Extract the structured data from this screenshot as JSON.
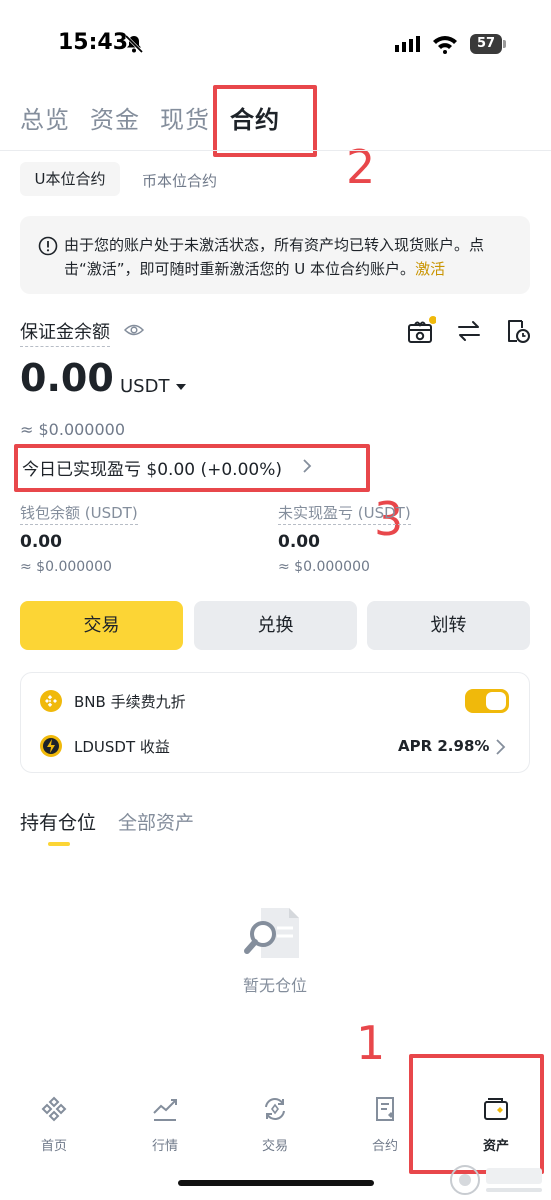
{
  "status_bar": {
    "time": "15:43",
    "battery": "57"
  },
  "top_tabs": [
    "总览",
    "资金",
    "现货",
    "合约"
  ],
  "sub_tabs": [
    "U本位合约",
    "币本位合约"
  ],
  "notice": {
    "text": "由于您的账户处于未激活状态，所有资产均已转入现货账户。点击“激活”，即可随时重新激活您的 U 本位合约账户。",
    "link": "激活"
  },
  "margin": {
    "label": "保证金余额",
    "amount": "0.00",
    "unit": "USDT",
    "usd_approx": "≈ $0.000000",
    "pnl_text": "今日已实现盈亏 $0.00 (+0.00%)"
  },
  "wallet": {
    "label": "钱包余额 (USDT)",
    "value": "0.00",
    "approx": "≈ $0.000000"
  },
  "unrealized": {
    "label": "未实现盈亏 (USDT)",
    "value": "0.00",
    "approx": "≈ $0.000000"
  },
  "actions": [
    "交易",
    "兑换",
    "划转"
  ],
  "bnb_row": {
    "label": "BNB 手续费九折",
    "toggle_on": true
  },
  "ld_row": {
    "label": "LDUSDT 收益",
    "apr": "APR 2.98%"
  },
  "position_tabs": [
    "持有仓位",
    "全部资产"
  ],
  "empty_text": "暂无仓位",
  "bottom_nav": [
    "首页",
    "行情",
    "交易",
    "合约",
    "资产"
  ],
  "annotations": [
    "1",
    "2",
    "3"
  ],
  "colors": {
    "accent": "#fcd535",
    "annotation": "#e8474b",
    "muted": "#848e9c"
  }
}
